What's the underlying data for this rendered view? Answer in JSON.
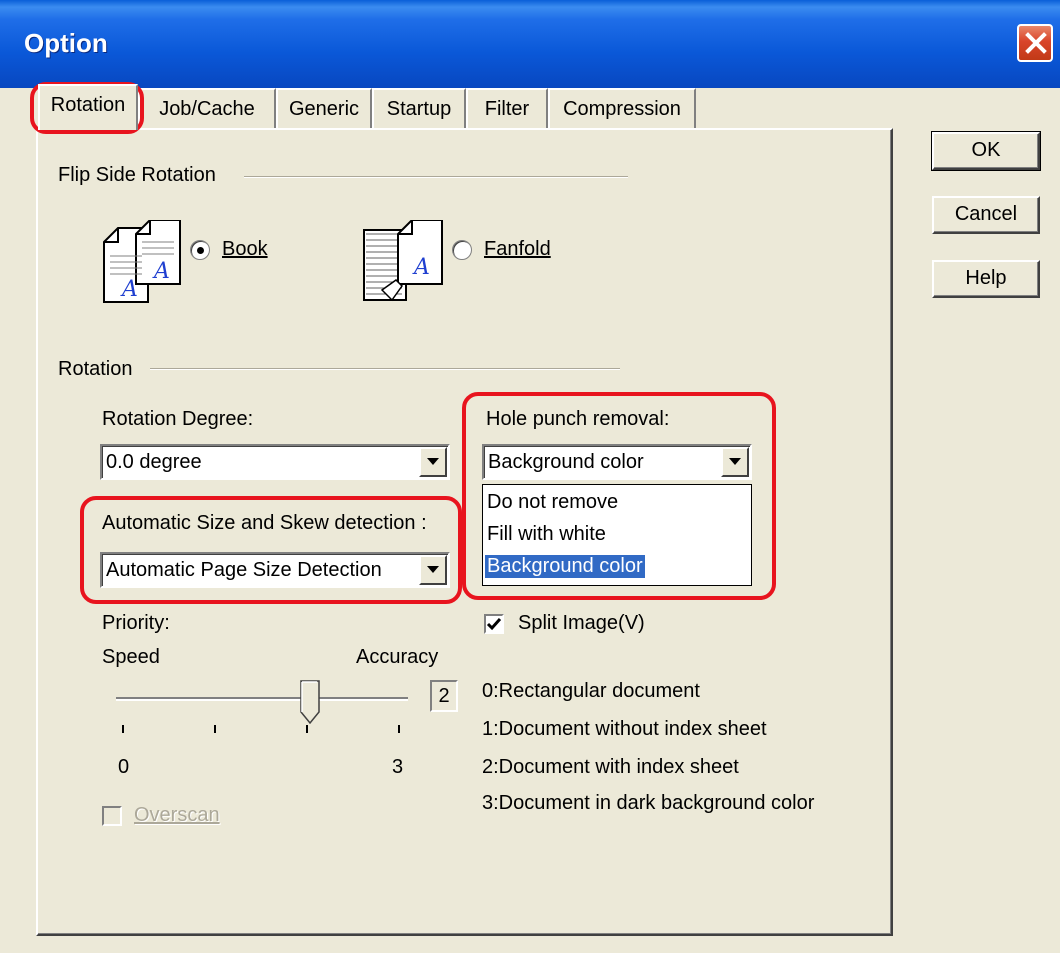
{
  "window": {
    "title": "Option"
  },
  "tabs": [
    {
      "label": "Rotation"
    },
    {
      "label": "Job/Cache"
    },
    {
      "label": "Generic"
    },
    {
      "label": "Startup"
    },
    {
      "label": "Filter"
    },
    {
      "label": "Compression"
    }
  ],
  "buttons": {
    "ok": "OK",
    "cancel": "Cancel",
    "help": "Help"
  },
  "flip_side": {
    "heading": "Flip Side Rotation",
    "book_label": "Book",
    "fanfold_label": "Fanfold",
    "selected": "Book",
    "icon_letter": "A"
  },
  "rotation": {
    "heading": "Rotation",
    "degree_label": "Rotation Degree:",
    "degree_value": "0.0 degree",
    "auto_label": "Automatic Size and Skew detection :",
    "auto_value": "Automatic Page Size Detection",
    "hole_label": "Hole punch removal:",
    "hole_value": "Background color",
    "hole_options": [
      "Do not remove",
      "Fill with white",
      "Background color"
    ],
    "hole_selected_index": 2,
    "split_label": "Split Image(V)",
    "split_checked": true,
    "priority_label": "Priority:",
    "speed_label": "Speed",
    "accuracy_label": "Accuracy",
    "slider_value": "2",
    "slider_min_label": "0",
    "slider_max_label": "3",
    "legend": [
      "0:Rectangular document",
      "1:Document without index sheet",
      "2:Document with index sheet",
      "3:Document in dark background color"
    ],
    "overscan_label": "Overscan",
    "overscan_enabled": false
  },
  "colors": {
    "titlebar": "#0a58d8",
    "highlight": "#e8141e",
    "selection": "#316ac5",
    "face": "#ece9d8"
  }
}
